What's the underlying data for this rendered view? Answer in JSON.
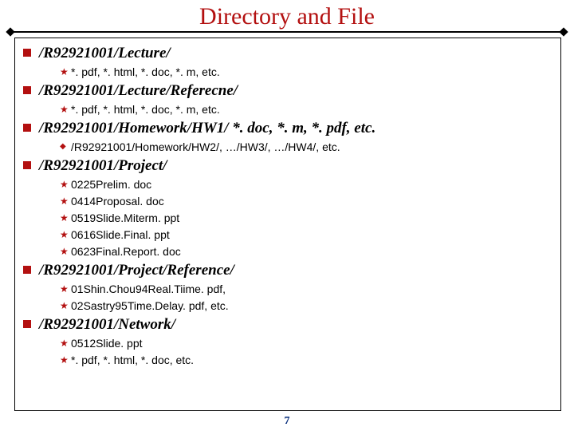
{
  "title": "Directory and File",
  "page_number": "7",
  "sections": [
    {
      "heading": "/R92921001/Lecture/",
      "bullet_style": "star",
      "items": [
        "*. pdf, *. html, *. doc, *. m, etc."
      ]
    },
    {
      "heading": "/R92921001/Lecture/Referecne/",
      "bullet_style": "star",
      "items": [
        "*. pdf, *. html, *. doc, *. m, etc."
      ]
    },
    {
      "heading": "/R92921001/Homework/HW1/ *. doc, *. m, *. pdf, etc.",
      "bullet_style": "diamond",
      "items": [
        "/R92921001/Homework/HW2/, …/HW3/, …/HW4/, etc."
      ]
    },
    {
      "heading": "/R92921001/Project/",
      "bullet_style": "star",
      "items": [
        "0225Prelim. doc",
        "0414Proposal. doc",
        "0519Slide.Miterm. ppt",
        "0616Slide.Final. ppt",
        "0623Final.Report. doc"
      ]
    },
    {
      "heading": "/R92921001/Project/Reference/",
      "bullet_style": "star",
      "items": [
        "01Shin.Chou94Real.Tiime. pdf,",
        "02Sastry95Time.Delay. pdf, etc."
      ]
    },
    {
      "heading": "/R92921001/Network/",
      "bullet_style": "star",
      "items": [
        "0512Slide. ppt",
        "*. pdf, *. html, *. doc, etc."
      ]
    }
  ]
}
